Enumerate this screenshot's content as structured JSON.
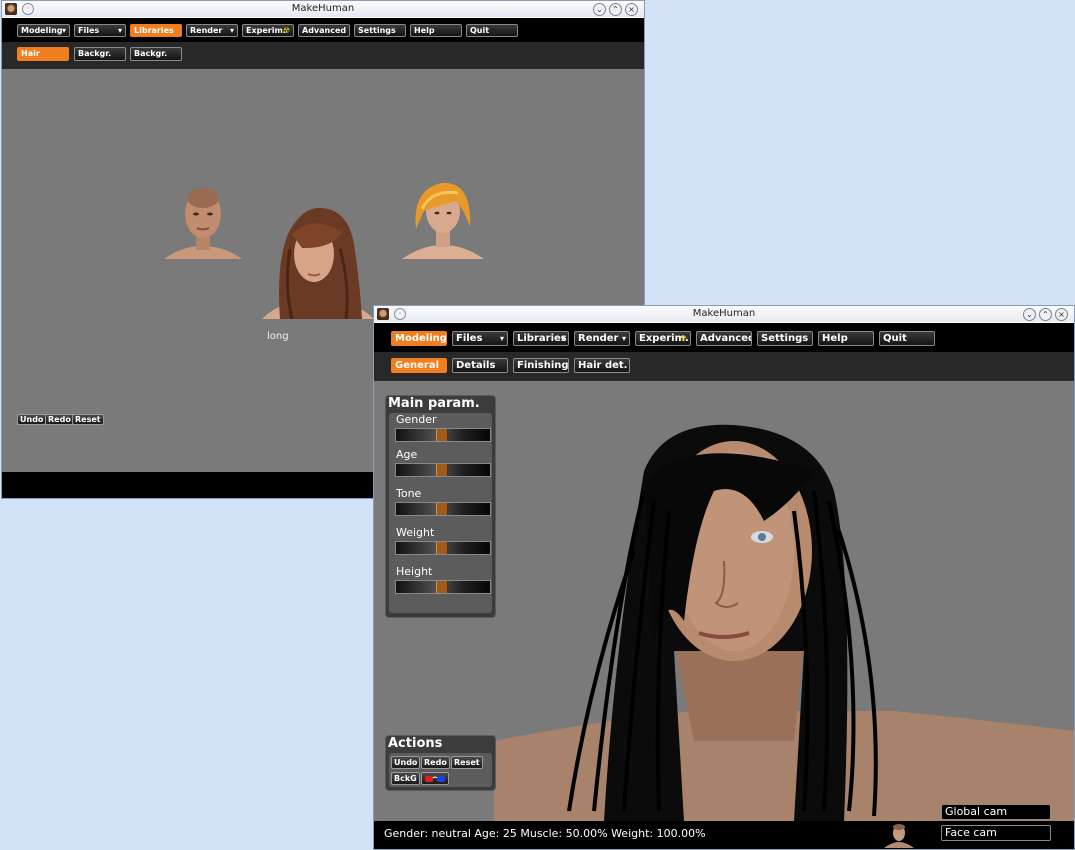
{
  "window1": {
    "title": "MakeHuman",
    "menu": [
      {
        "label": "Modeling",
        "caret": "▾"
      },
      {
        "label": "Files",
        "caret": "▾"
      },
      {
        "label": "Libraries",
        "caret": ""
      },
      {
        "label": "Render",
        "caret": "▾"
      },
      {
        "label": "Experim.",
        "caret": "☢"
      },
      {
        "label": "Advanced",
        "caret": ""
      },
      {
        "label": "Settings",
        "caret": ""
      },
      {
        "label": "Help",
        "caret": ""
      },
      {
        "label": "Quit",
        "caret": ""
      }
    ],
    "active_menu": "Libraries",
    "subtabs": [
      "Hair",
      "Backgr.",
      "Backgr."
    ],
    "active_subtab": "Hair",
    "selected_caption": "long",
    "actions": [
      "Undo",
      "Redo",
      "Reset"
    ],
    "hair_thumbnails": [
      "bald",
      "long",
      "short-blonde"
    ]
  },
  "window2": {
    "title": "MakeHuman",
    "menu": [
      {
        "label": "Modeling",
        "caret": ""
      },
      {
        "label": "Files",
        "caret": "▾"
      },
      {
        "label": "Libraries",
        "caret": "▾"
      },
      {
        "label": "Render",
        "caret": "▾"
      },
      {
        "label": "Experim.",
        "caret": "☢"
      },
      {
        "label": "Advanced",
        "caret": ""
      },
      {
        "label": "Settings",
        "caret": ""
      },
      {
        "label": "Help",
        "caret": ""
      },
      {
        "label": "Quit",
        "caret": ""
      }
    ],
    "active_menu": "Modeling",
    "subtabs": [
      "General",
      "Details",
      "Finishing",
      "Hair det."
    ],
    "active_subtab": "General",
    "main_params": {
      "title": "Main param.",
      "sliders": [
        {
          "label": "Gender",
          "value": 0.5
        },
        {
          "label": "Age",
          "value": 0.5
        },
        {
          "label": "Tone",
          "value": 0.5
        },
        {
          "label": "Weight",
          "value": 0.5
        },
        {
          "label": "Height",
          "value": 0.5
        }
      ]
    },
    "actions": {
      "title": "Actions",
      "buttons": [
        "Undo",
        "Redo",
        "Reset",
        "BckG"
      ]
    },
    "status": "Gender: neutral  Age: 25  Muscle: 50.00%  Weight: 100.00%",
    "cameras": [
      "Global cam",
      "Face cam"
    ]
  },
  "colors": {
    "accent": "#f07e1e",
    "desktop": "#d4e2f7",
    "viewport_gray": "#7a7a7a"
  }
}
